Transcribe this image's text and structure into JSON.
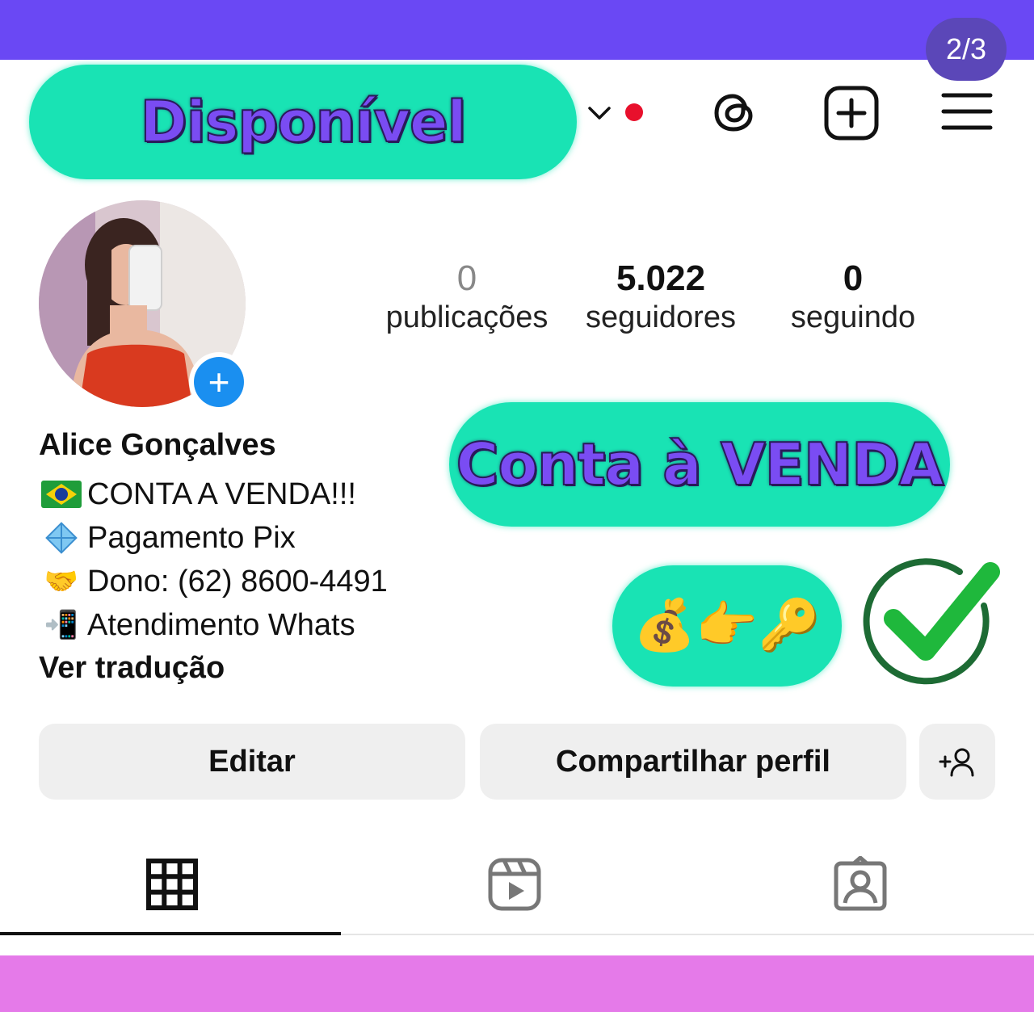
{
  "page_counter": "2/3",
  "overlays": {
    "availability": "Disponível",
    "sale_banner": "Conta à VENDA",
    "emoji_banner": "💰👉🔑"
  },
  "header": {
    "icons": [
      "chevron-down-icon",
      "notification-dot",
      "threads-icon",
      "new-post-icon",
      "menu-icon"
    ]
  },
  "profile": {
    "stats": [
      {
        "value": "0",
        "label": "publicações"
      },
      {
        "value": "5.022",
        "label": "seguidores"
      },
      {
        "value": "0",
        "label": "seguindo"
      }
    ],
    "name": "Alice Gonçalves",
    "bio": [
      {
        "icon": "brazil-flag-icon",
        "text": "CONTA A VENDA!!!"
      },
      {
        "icon": "pix-icon",
        "text": "Pagamento Pix"
      },
      {
        "icon": "handshake-icon",
        "text": "Dono: (62) 8600-4491"
      },
      {
        "icon": "mobile-phone-arrow-icon",
        "text": "Atendimento Whats"
      }
    ],
    "translate_link": "Ver tradução"
  },
  "actions": {
    "edit": "Editar",
    "share": "Compartilhar perfil"
  },
  "tabs": [
    "grid-icon",
    "reels-icon",
    "tagged-icon"
  ],
  "colors": {
    "top_band": "#6a48f4",
    "bottom_band": "#e57ae9",
    "pill_bg": "#19e3b4",
    "pill_text": "#7a4cf3",
    "check_green": "#1fb83c",
    "avatar_badge": "#1a8ff0"
  }
}
